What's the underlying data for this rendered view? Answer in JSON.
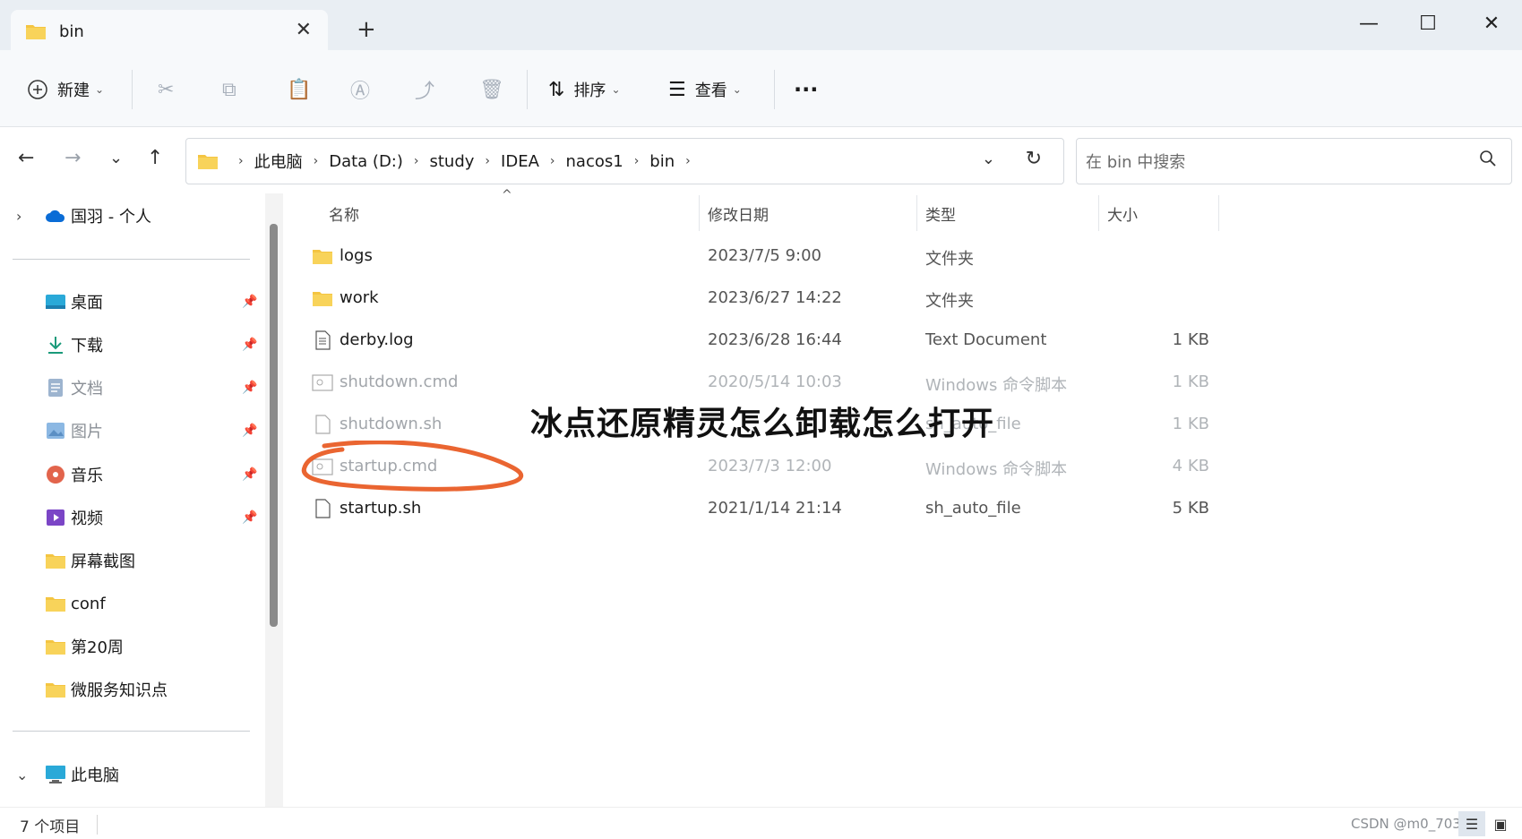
{
  "window": {
    "tab_title": "bin",
    "tab_close": "✕",
    "new_tab": "+",
    "minimize": "—",
    "maximize": "☐",
    "close": "✕"
  },
  "toolbar": {
    "new_label": "新建",
    "sort_label": "排序",
    "view_label": "查看",
    "more_label": "···"
  },
  "address": {
    "crumbs": [
      "此电脑",
      "Data (D:)",
      "study",
      "IDEA",
      "nacos1",
      "bin"
    ],
    "search_placeholder": "在 bin 中搜索"
  },
  "sidebar": {
    "cloud": "国羽 - 个人",
    "items": [
      {
        "label": "桌面"
      },
      {
        "label": "下载"
      },
      {
        "label": "文档"
      },
      {
        "label": "图片"
      },
      {
        "label": "音乐"
      },
      {
        "label": "视频"
      },
      {
        "label": "屏幕截图"
      },
      {
        "label": "conf"
      },
      {
        "label": "第20周"
      },
      {
        "label": "微服务知识点"
      }
    ],
    "this_pc": "此电脑"
  },
  "columns": {
    "name": "名称",
    "date": "修改日期",
    "type": "类型",
    "size": "大小"
  },
  "files": [
    {
      "name": "logs",
      "date": "2023/7/5 9:00",
      "type": "文件夹",
      "size": ""
    },
    {
      "name": "work",
      "date": "2023/6/27 14:22",
      "type": "文件夹",
      "size": ""
    },
    {
      "name": "derby.log",
      "date": "2023/6/28 16:44",
      "type": "Text Document",
      "size": "1 KB"
    },
    {
      "name": "shutdown.cmd",
      "date": "2020/5/14 10:03",
      "type": "Windows 命令脚本",
      "size": "1 KB"
    },
    {
      "name": "shutdown.sh",
      "date": "",
      "type": "sh_auto_file",
      "size": "1 KB"
    },
    {
      "name": "startup.cmd",
      "date": "2023/7/3 12:00",
      "type": "Windows 命令脚本",
      "size": "4 KB"
    },
    {
      "name": "startup.sh",
      "date": "2021/1/14 21:14",
      "type": "sh_auto_file",
      "size": "5 KB"
    }
  ],
  "overlay": {
    "title": "冰点还原精灵怎么卸载怎么打开"
  },
  "status": {
    "count": "7 个项目",
    "watermark": "CSDN @m0_703"
  },
  "colors": {
    "folder": "#f4c542",
    "circle": "#e8541b",
    "accent": "#0067c0"
  }
}
